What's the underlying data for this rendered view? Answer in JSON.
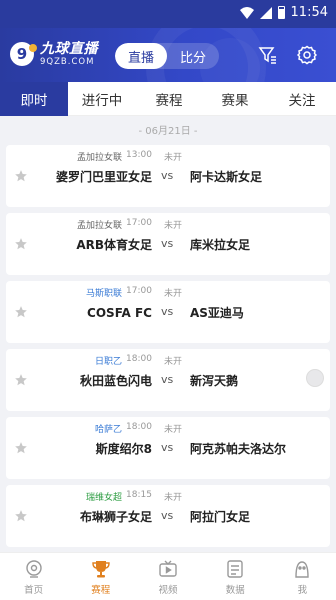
{
  "status_bar": {
    "time": "11:54"
  },
  "header": {
    "logo_glyph": "9",
    "logo_title": "九球直播",
    "logo_sub": "9QZB.COM",
    "segments": [
      {
        "label": "直播",
        "active": true
      },
      {
        "label": "比分",
        "active": false
      }
    ],
    "icons": [
      "filter-icon",
      "gear-icon"
    ]
  },
  "tabs": [
    {
      "label": "即时",
      "active": true
    },
    {
      "label": "进行中",
      "active": false
    },
    {
      "label": "赛程",
      "active": false
    },
    {
      "label": "赛果",
      "active": false
    },
    {
      "label": "关注",
      "active": false
    }
  ],
  "date_label": "- 06月21日 -",
  "matches": [
    {
      "league": "孟加拉女联",
      "league_color": "#666666",
      "time": "13:00",
      "status": "未开",
      "home": "婆罗门巴里亚女足",
      "vs": "vs",
      "away": "阿卡达斯女足"
    },
    {
      "league": "孟加拉女联",
      "league_color": "#666666",
      "time": "17:00",
      "status": "未开",
      "home": "ARB体育女足",
      "vs": "vs",
      "away": "库米拉女足"
    },
    {
      "league": "马斯职联",
      "league_color": "#3a7bd5",
      "time": "17:00",
      "status": "未开",
      "home": "COSFA FC",
      "vs": "vs",
      "away": "AS亚迪马"
    },
    {
      "league": "日职乙",
      "league_color": "#3a7bd5",
      "time": "18:00",
      "status": "未开",
      "home": "秋田蓝色闪电",
      "vs": "vs",
      "away": "新泻天鹅"
    },
    {
      "league": "哈萨乙",
      "league_color": "#3a7bd5",
      "time": "18:00",
      "status": "未开",
      "home": "斯度绍尔8",
      "vs": "vs",
      "away": "阿克苏帕夫洛达尔"
    },
    {
      "league": "瑞维女超",
      "league_color": "#2f9e44",
      "time": "18:15",
      "status": "未开",
      "home": "布琳狮子女足",
      "vs": "vs",
      "away": "阿拉门女足"
    }
  ],
  "bottom_nav": [
    {
      "label": "首页",
      "icon": "home-icon",
      "active": false
    },
    {
      "label": "赛程",
      "icon": "trophy-icon",
      "active": true
    },
    {
      "label": "视频",
      "icon": "video-icon",
      "active": false
    },
    {
      "label": "数据",
      "icon": "data-icon",
      "active": false
    },
    {
      "label": "我",
      "icon": "profile-icon",
      "active": false
    }
  ],
  "colors": {
    "primary": "#2a3ba0",
    "accent": "#e0801f",
    "star": "#c8c8c8"
  }
}
